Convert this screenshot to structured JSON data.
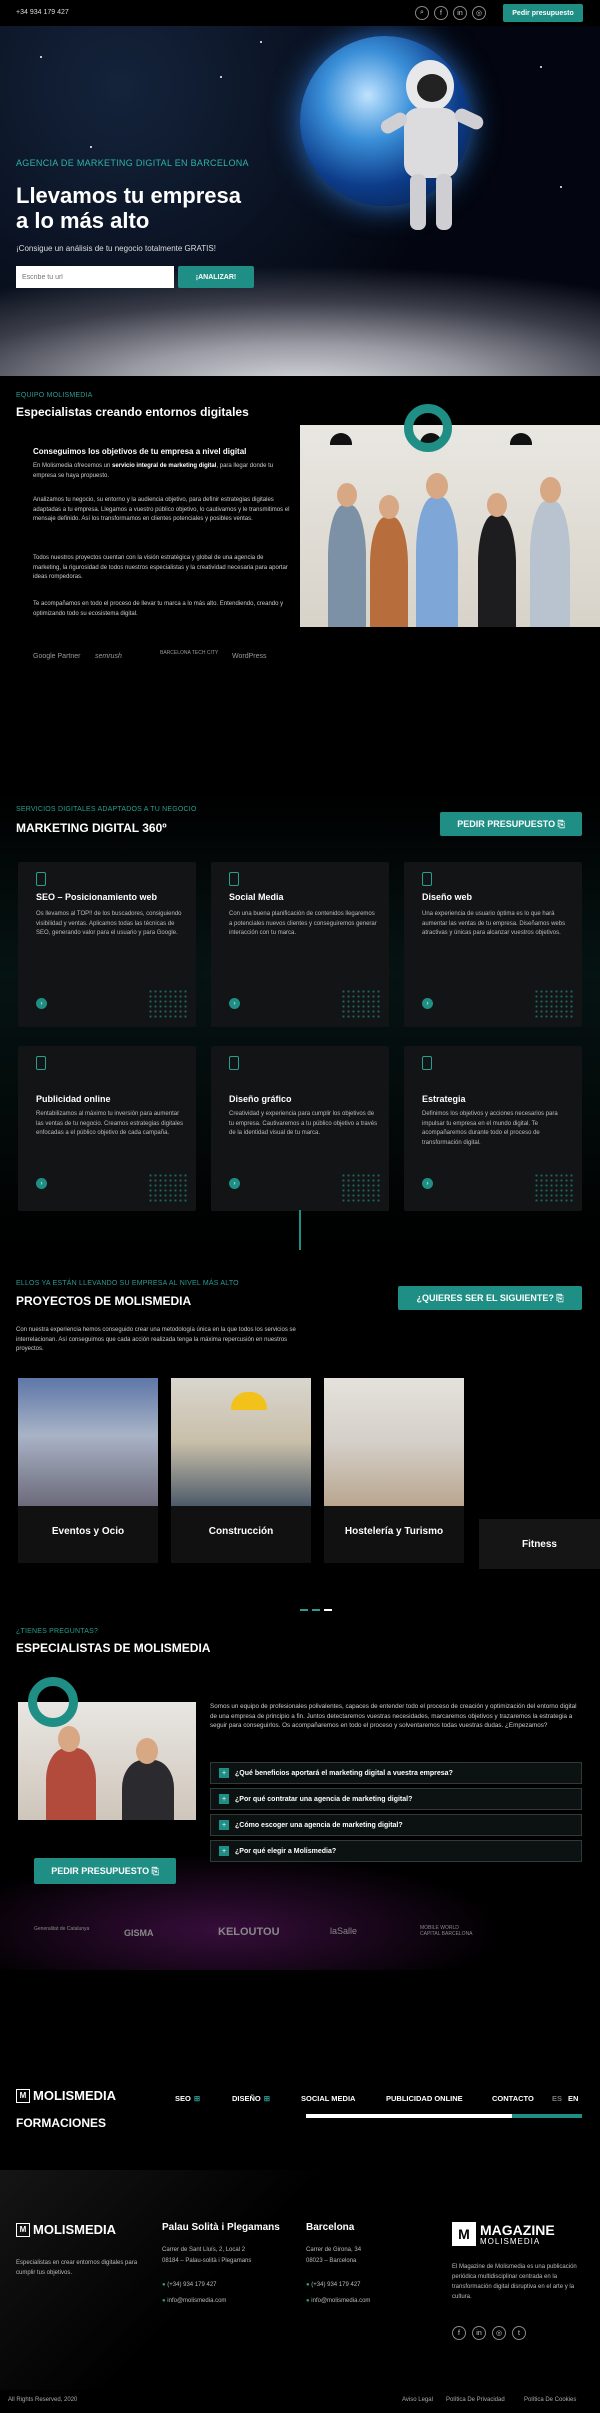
{
  "topbar": {
    "phone": "+34 934 179 427",
    "cta": "Pedir presupuesto",
    "icons": [
      "search-icon",
      "facebook-icon",
      "linkedin-icon",
      "instagram-icon"
    ]
  },
  "hero": {
    "kicker": "AGENCIA DE MARKETING DIGITAL EN BARCELONA",
    "title_line1": "Llevamos tu empresa",
    "title_line2": "a lo más alto",
    "subtitle": "¡Consigue un análisis de tu negocio totalmente GRATIS!",
    "input_placeholder": "Escribe tu url",
    "button": "¡ANALIZAR!"
  },
  "team": {
    "kicker": "EQUIPO MOLISMEDIA",
    "title": "Especialistas creando entornos digitales",
    "heading": "Conseguimos los objetivos de tu empresa a nivel digital",
    "p1a": "En Molismedia ofrecemos un ",
    "p1b": "servicio integral de marketing digital",
    "p1c": ", para llegar donde tu empresa se haya propuesto.",
    "p2": "Analizamos tu negocio, su entorno y la audiencia objetivo, para definir estrategias digitales adaptadas a tu empresa. Llegamos a vuestro público objetivo, lo cautivamos y le transmitimos el mensaje definido. Así los transformamos en clientes potenciales y posibles ventas.",
    "p3": "Todos nuestros proyectos cuentan con la visión estratégica y global de una agencia de marketing, la rigurosidad de todos nuestros especialistas y la creatividad necesaria para aportar ideas rompedoras.",
    "p4": "Te acompañamos en todo el proceso de llevar tu marca a lo más alto. Entendiendo, creando y optimizando todo su ecosistema digital.",
    "partners": [
      "Google Partner",
      "semrush",
      "BARCELONA TECH CITY",
      "WordPress"
    ]
  },
  "services": {
    "kicker": "SERVICIOS DIGITALES ADAPTADOS A TU NEGOCIO",
    "title": "MARKETING DIGITAL 360º",
    "cta": "PEDIR PRESUPUESTO",
    "cards": [
      {
        "title": "SEO – Posicionamiento web",
        "text": "Os llevamos al TOP!! de los buscadores, consiguiendo visibilidad y ventas. Aplicamos todas las técnicas de SEO, generando valor para el usuario y para Google."
      },
      {
        "title": "Social Media",
        "text": "Con una buena planificación de contenidos llegaremos a potenciales nuevos clientes y conseguiremos generar interacción con tu marca."
      },
      {
        "title": "Diseño web",
        "text": "Una experiencia de usuario óptima es lo que hará aumentar las ventas de tu empresa. Diseñamos webs atractivas y únicas para alcanzar vuestros objetivos."
      },
      {
        "title": "Publicidad online",
        "text": "Rentabilizamos al máximo tu inversión para aumentar las ventas de tu negocio. Creamos estrategias digitales enfocadas a el público objetivo de cada campaña."
      },
      {
        "title": "Diseño gráfico",
        "text": "Creatividad y experiencia para cumplir los objetivos de tu empresa. Cautivaremos a tu público objetivo a través de la identidad visual de tu marca."
      },
      {
        "title": "Estrategia",
        "text": "Definimos los objetivos y acciones necesarios para impulsar tu empresa en el mundo digital. Te acompañaremos durante todo el proceso de transformación digital."
      }
    ]
  },
  "projects": {
    "kicker": "ELLOS YA ESTÁN LLEVANDO SU EMPRESA AL NIVEL MÁS ALTO",
    "title": "PROYECTOS DE MOLISMEDIA",
    "cta": "¿QUIERES SER EL SIGUIENTE?",
    "text": "Con nuestra experiencia hemos conseguido crear una metodología única en la que todos los servicios se interrelacionan. Así conseguimos que cada acción realizada tenga la máxima repercusión en nuestros proyectos.",
    "sectors": [
      "Eventos y Ocio",
      "Construcción",
      "Hostelería y Turismo",
      "Fitness"
    ]
  },
  "faq": {
    "kicker": "¿TIENES PREGUNTAS?",
    "title": "ESPECIALISTAS DE MOLISMEDIA",
    "intro": "Somos un equipo de profesionales polivalentes, capaces de entender todo el proceso de creación y optimización del entorno digital de una empresa de principio a fin. Juntos detectaremos vuestras necesidades, marcaremos objetivos y trazaremos la estrategia a seguir para conseguirlos. Os acompañaremos en todo el proceso y solventaremos todas vuestras dudas. ¿Empezamos?",
    "cta": "PEDIR PRESUPUESTO",
    "questions": [
      "¿Qué beneficios aportará el marketing digital a vuestra empresa?",
      "¿Por qué contratar una agencia de marketing digital?",
      "¿Cómo escoger una agencia de marketing digital?",
      "¿Por qué elegir a Molismedia?"
    ],
    "logos": [
      "Generalitat de Catalunya",
      "GISMA",
      "KELOUTOU",
      "laSalle",
      "MOBILE WORLD CAPITAL BARCELONA"
    ]
  },
  "nav": {
    "logo": "MOLISMEDIA",
    "items": [
      "SEO",
      "DISEÑO",
      "SOCIAL MEDIA",
      "PUBLICIDAD ONLINE",
      "CONTACTO"
    ],
    "lang_es": "ES",
    "lang_en": "EN",
    "formaciones": "FORMACIONES"
  },
  "footer": {
    "logo": "MOLISMEDIA",
    "tagline": "Especialistas en crear entornos digitales para cumplir tus objetivos.",
    "col1_title": "Palau Solità i Plegamans",
    "col1_addr1": "Carrer de Sant Lluís, 2, Local 2",
    "col1_addr2": "08184 – Palau-solità i Plegamans",
    "col1_phone": "(+34) 934 179 427",
    "col1_email": "info@molismedia.com",
    "col2_title": "Barcelona",
    "col2_addr1": "Carrer de Girona, 34",
    "col2_addr2": "08023 – Barcelona",
    "col2_phone": "(+34) 934 179 427",
    "col2_email": "info@molismedia.com",
    "magazine_title": "MAGAZINE",
    "magazine_sub": "MOLISMEDIA",
    "magazine_text": "El Magazine de Molismedia es una publicación periódica multidisciplinar centrada en la transformación digital disruptiva en el arte y la cultura.",
    "copyright": "All Rights Reserved, 2020",
    "legal": [
      "Aviso Legal",
      "Política De Privacidad",
      "Política De Cookies"
    ]
  },
  "colors": {
    "accent": "#1f8f86",
    "background": "#000000",
    "card": "#121416"
  }
}
